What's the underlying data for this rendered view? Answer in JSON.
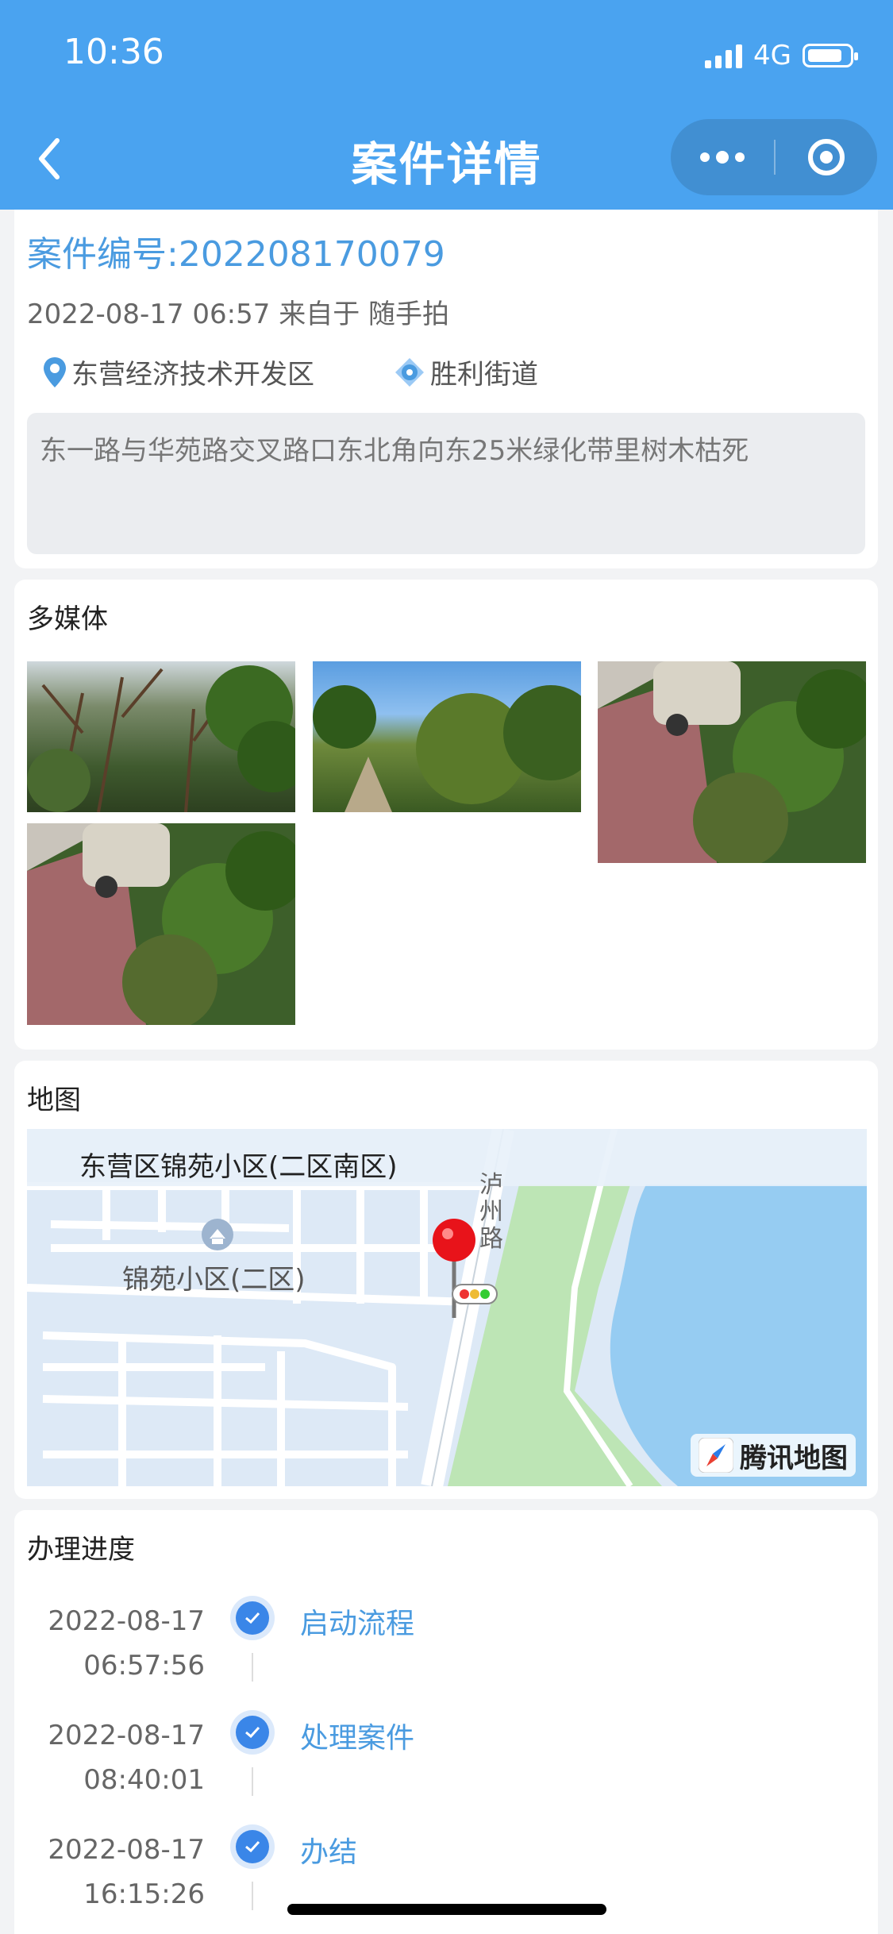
{
  "status_bar": {
    "time": "10:36",
    "network": "4G"
  },
  "nav": {
    "title": "案件详情"
  },
  "case": {
    "id_label": "案件编号:202208170079",
    "meta": "2022-08-17 06:57 来自于 随手拍",
    "district": "东营经济技术开发区",
    "street": "胜利街道",
    "description": "东一路与华苑路交叉路口东北角向东25米绿化带里树木枯死"
  },
  "media": {
    "title": "多媒体",
    "photo_count": 4
  },
  "map": {
    "title": "地图",
    "label_area": "东营区锦苑小区(二区南区)",
    "label_community": "锦苑小区(二区)",
    "label_road": "泸州路",
    "provider": "腾讯地图"
  },
  "progress": {
    "title": "办理进度",
    "steps": [
      {
        "date": "2022-08-17",
        "time": "06:57:56",
        "label": "启动流程"
      },
      {
        "date": "2022-08-17",
        "time": "08:40:01",
        "label": "处理案件"
      },
      {
        "date": "2022-08-17",
        "time": "16:15:26",
        "label": "办结"
      }
    ]
  },
  "colors": {
    "header": "#4aa3f0",
    "accent": "#4a9be0",
    "check": "#3a86e8"
  }
}
